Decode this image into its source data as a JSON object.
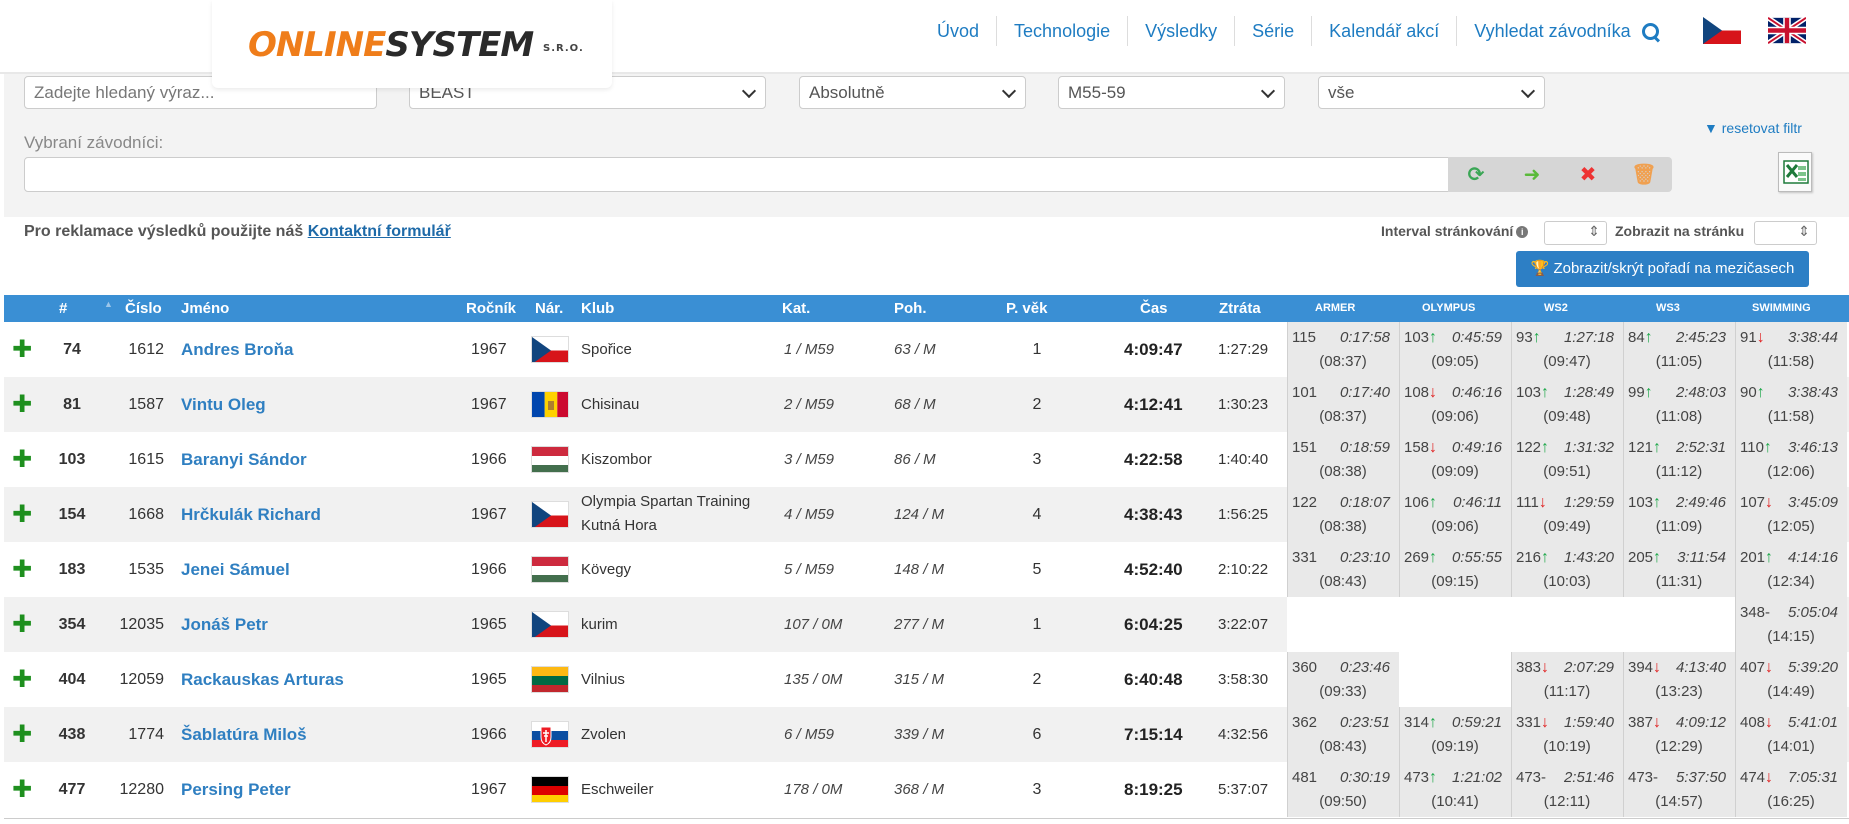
{
  "logo": {
    "part1": "ONLINE",
    "part2": "SYSTEM",
    "suffix": "S.R.O."
  },
  "nav": {
    "items": [
      "Úvod",
      "Technologie",
      "Výsledky",
      "Série",
      "Kalendář akcí",
      "Vyhledat závodníka"
    ]
  },
  "filters": {
    "search_placeholder": "Zadejte hledaný výraz...",
    "race": "BEAST",
    "mode": "Absolutně",
    "category": "M55-59",
    "gender": "vše",
    "selected_label": "Vybraní závodníci:",
    "reset": "resetovat filtr"
  },
  "info": {
    "claim_prefix": "Pro reklamace výsledků použijte náš",
    "claim_link": "Kontaktní formulář",
    "interval_label": "Interval stránkování",
    "per_page_label": "Zobrazit na stránku",
    "toggle_splits": "Zobrazit/skrýt pořadí na mezičasech"
  },
  "table": {
    "headers": {
      "rank": "#",
      "number": "Číslo",
      "name": "Jméno",
      "year": "Ročník",
      "nat": "Nár.",
      "club": "Klub",
      "cat": "Kat.",
      "pos": "Poh.",
      "agegroup": "P. věk",
      "time": "Čas",
      "loss": "Ztráta"
    },
    "split_headers": [
      "ARMER",
      "OLYMPUS",
      "WS2",
      "WS3",
      "SWIMMING"
    ],
    "rows": [
      {
        "rank": "74",
        "number": "1612",
        "name": "Andres Broňa",
        "year": "1967",
        "flag": "cz",
        "club": "Spořice",
        "cat": "1 / M59",
        "pos": "63 / M",
        "age": "1",
        "time": "4:09:47",
        "loss": "1:27:29",
        "splits": [
          {
            "rank": "115",
            "arrow": "",
            "time": "0:17:58",
            "pace": "(08:37)"
          },
          {
            "rank": "103",
            "arrow": "up",
            "time": "0:45:59",
            "pace": "(09:05)"
          },
          {
            "rank": "93",
            "arrow": "up",
            "time": "1:27:18",
            "pace": "(09:47)"
          },
          {
            "rank": "84",
            "arrow": "up",
            "time": "2:45:23",
            "pace": "(11:05)"
          },
          {
            "rank": "91",
            "arrow": "down",
            "time": "3:38:44",
            "pace": "(11:58)"
          }
        ]
      },
      {
        "rank": "81",
        "number": "1587",
        "name": "Vintu Oleg",
        "year": "1967",
        "flag": "md",
        "club": "Chisinau",
        "cat": "2 / M59",
        "pos": "68 / M",
        "age": "2",
        "time": "4:12:41",
        "loss": "1:30:23",
        "splits": [
          {
            "rank": "101",
            "arrow": "",
            "time": "0:17:40",
            "pace": "(08:37)"
          },
          {
            "rank": "108",
            "arrow": "down",
            "time": "0:46:16",
            "pace": "(09:06)"
          },
          {
            "rank": "103",
            "arrow": "up",
            "time": "1:28:49",
            "pace": "(09:48)"
          },
          {
            "rank": "99",
            "arrow": "up",
            "time": "2:48:03",
            "pace": "(11:08)"
          },
          {
            "rank": "90",
            "arrow": "up",
            "time": "3:38:43",
            "pace": "(11:58)"
          }
        ]
      },
      {
        "rank": "103",
        "number": "1615",
        "name": "Baranyi Sándor",
        "year": "1966",
        "flag": "hu",
        "club": "Kiszombor",
        "cat": "3 / M59",
        "pos": "86 / M",
        "age": "3",
        "time": "4:22:58",
        "loss": "1:40:40",
        "splits": [
          {
            "rank": "151",
            "arrow": "",
            "time": "0:18:59",
            "pace": "(08:38)"
          },
          {
            "rank": "158",
            "arrow": "down",
            "time": "0:49:16",
            "pace": "(09:09)"
          },
          {
            "rank": "122",
            "arrow": "up",
            "time": "1:31:32",
            "pace": "(09:51)"
          },
          {
            "rank": "121",
            "arrow": "up",
            "time": "2:52:31",
            "pace": "(11:12)"
          },
          {
            "rank": "110",
            "arrow": "up",
            "time": "3:46:13",
            "pace": "(12:06)"
          }
        ]
      },
      {
        "rank": "154",
        "number": "1668",
        "name": "Hrčkulák Richard",
        "year": "1967",
        "flag": "cz",
        "club": "Olympia Spartan Training",
        "club2": "Kutná Hora",
        "cat": "4 / M59",
        "pos": "124 / M",
        "age": "4",
        "time": "4:38:43",
        "loss": "1:56:25",
        "splits": [
          {
            "rank": "122",
            "arrow": "",
            "time": "0:18:07",
            "pace": "(08:38)"
          },
          {
            "rank": "106",
            "arrow": "up",
            "time": "0:46:11",
            "pace": "(09:06)"
          },
          {
            "rank": "111",
            "arrow": "down",
            "time": "1:29:59",
            "pace": "(09:49)"
          },
          {
            "rank": "103",
            "arrow": "up",
            "time": "2:49:46",
            "pace": "(11:09)"
          },
          {
            "rank": "107",
            "arrow": "down",
            "time": "3:45:09",
            "pace": "(12:05)"
          }
        ]
      },
      {
        "rank": "183",
        "number": "1535",
        "name": "Jenei Sámuel",
        "year": "1966",
        "flag": "hu",
        "club": "Kövegy",
        "cat": "5 / M59",
        "pos": "148 / M",
        "age": "5",
        "time": "4:52:40",
        "loss": "2:10:22",
        "splits": [
          {
            "rank": "331",
            "arrow": "",
            "time": "0:23:10",
            "pace": "(08:43)"
          },
          {
            "rank": "269",
            "arrow": "up",
            "time": "0:55:55",
            "pace": "(09:15)"
          },
          {
            "rank": "216",
            "arrow": "up",
            "time": "1:43:20",
            "pace": "(10:03)"
          },
          {
            "rank": "205",
            "arrow": "up",
            "time": "3:11:54",
            "pace": "(11:31)"
          },
          {
            "rank": "201",
            "arrow": "up",
            "time": "4:14:16",
            "pace": "(12:34)"
          }
        ]
      },
      {
        "rank": "354",
        "number": "12035",
        "name": "Jonáš Petr",
        "year": "1965",
        "flag": "cz",
        "club": "kurim",
        "cat": "107 / 0M",
        "pos": "277 / M",
        "age": "1",
        "time": "6:04:25",
        "loss": "3:22:07",
        "splits": [
          null,
          null,
          null,
          null,
          {
            "rank": "348",
            "arrow": "dash",
            "time": "5:05:04",
            "pace": "(14:15)"
          }
        ]
      },
      {
        "rank": "404",
        "number": "12059",
        "name": "Rackauskas Arturas",
        "year": "1965",
        "flag": "lt",
        "club": "Vilnius",
        "cat": "135 / 0M",
        "pos": "315 / M",
        "age": "2",
        "time": "6:40:48",
        "loss": "3:58:30",
        "splits": [
          {
            "rank": "360",
            "arrow": "",
            "time": "0:23:46",
            "pace": "(09:33)"
          },
          null,
          {
            "rank": "383",
            "arrow": "down",
            "time": "2:07:29",
            "pace": "(11:17)"
          },
          {
            "rank": "394",
            "arrow": "down",
            "time": "4:13:40",
            "pace": "(13:23)"
          },
          {
            "rank": "407",
            "arrow": "down",
            "time": "5:39:20",
            "pace": "(14:49)"
          }
        ]
      },
      {
        "rank": "438",
        "number": "1774",
        "name": "Šablatúra Miloš",
        "year": "1966",
        "flag": "sk",
        "club": "Zvolen",
        "cat": "6 / M59",
        "pos": "339 / M",
        "age": "6",
        "time": "7:15:14",
        "loss": "4:32:56",
        "splits": [
          {
            "rank": "362",
            "arrow": "",
            "time": "0:23:51",
            "pace": "(08:43)"
          },
          {
            "rank": "314",
            "arrow": "up",
            "time": "0:59:21",
            "pace": "(09:19)"
          },
          {
            "rank": "331",
            "arrow": "down",
            "time": "1:59:40",
            "pace": "(10:19)"
          },
          {
            "rank": "387",
            "arrow": "down",
            "time": "4:09:12",
            "pace": "(12:29)"
          },
          {
            "rank": "408",
            "arrow": "down",
            "time": "5:41:01",
            "pace": "(14:01)"
          }
        ]
      },
      {
        "rank": "477",
        "number": "12280",
        "name": "Persing Peter",
        "year": "1967",
        "flag": "de",
        "club": "Eschweiler",
        "cat": "178 / 0M",
        "pos": "368 / M",
        "age": "3",
        "time": "8:19:25",
        "loss": "5:37:07",
        "splits": [
          {
            "rank": "481",
            "arrow": "",
            "time": "0:30:19",
            "pace": "(09:50)"
          },
          {
            "rank": "473",
            "arrow": "up",
            "time": "1:21:02",
            "pace": "(10:41)"
          },
          {
            "rank": "473",
            "arrow": "dash",
            "time": "2:51:46",
            "pace": "(12:11)"
          },
          {
            "rank": "473",
            "arrow": "dash",
            "time": "5:37:50",
            "pace": "(14:57)"
          },
          {
            "rank": "474",
            "arrow": "down",
            "time": "7:05:31",
            "pace": "(16:25)"
          }
        ]
      }
    ]
  }
}
